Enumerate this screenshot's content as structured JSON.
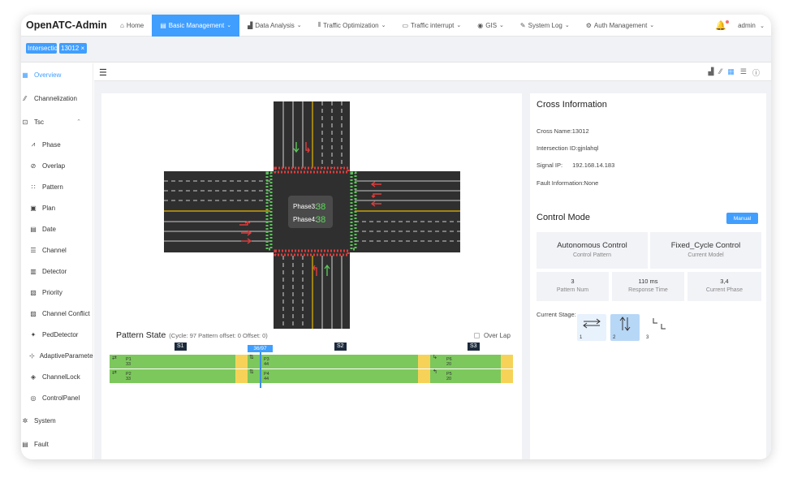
{
  "nav": {
    "brand": "OpenATC-Admin",
    "items": [
      {
        "label": "Home",
        "icon": "home-icon"
      },
      {
        "label": "Basic Management",
        "icon": "database-icon"
      },
      {
        "label": "Data Analysis",
        "icon": "chart-icon"
      },
      {
        "label": "Traffic Optimization",
        "icon": "bars-icon"
      },
      {
        "label": "Traffic interrupt",
        "icon": "video-icon"
      },
      {
        "label": "GIS",
        "icon": "location-icon"
      },
      {
        "label": "System Log",
        "icon": "edit-icon"
      },
      {
        "label": "Auth Management",
        "icon": "gear-icon"
      }
    ],
    "user": "admin"
  },
  "tags": {
    "t1": "Intersection",
    "t2": "13012 ×"
  },
  "sidebar": {
    "items": [
      {
        "label": "Overview"
      },
      {
        "label": "Channelization"
      },
      {
        "label": "Tsc"
      },
      {
        "label": "Phase"
      },
      {
        "label": "Overlap"
      },
      {
        "label": "Pattern"
      },
      {
        "label": "Plan"
      },
      {
        "label": "Date"
      },
      {
        "label": "Channel"
      },
      {
        "label": "Detector"
      },
      {
        "label": "Priority"
      },
      {
        "label": "Channel Conflict"
      },
      {
        "label": "PedDetector"
      },
      {
        "label": "AdaptiveParameter"
      },
      {
        "label": "ChannelLock"
      },
      {
        "label": "ControlPanel"
      },
      {
        "label": "System"
      },
      {
        "label": "Fault"
      }
    ]
  },
  "intersection": {
    "phase3_label": "Phase3:",
    "phase3_value": "38",
    "phase4_label": "Phase4:",
    "phase4_value": "38"
  },
  "pattern": {
    "title": "Pattern State",
    "subtitle": "(Cycle: 97 Pattern offset: 0 Offset: 0)",
    "overlap_label": "Over Lap",
    "cursor": "36/97",
    "stages": [
      "S1",
      "S2",
      "S3"
    ],
    "phases": [
      {
        "name": "P1",
        "time": "33"
      },
      {
        "name": "P2",
        "time": "33"
      },
      {
        "name": "P3",
        "time": "44"
      },
      {
        "name": "P4",
        "time": "44"
      },
      {
        "name": "P6",
        "time": "20"
      },
      {
        "name": "P5",
        "time": "20"
      }
    ]
  },
  "cross": {
    "title": "Cross Information",
    "name_label": "Cross Name:",
    "name": "13012",
    "id_label": "Intersection ID:",
    "id": "gjnlahql",
    "ip_label": "Signal IP:",
    "ip": "192.168.14.183",
    "fault_label": "Fault Information:",
    "fault": "None"
  },
  "control": {
    "title": "Control Mode",
    "manual_button": "Manual",
    "cards": [
      {
        "value": "Autonomous Control",
        "label": "Control Pattern"
      },
      {
        "value": "Fixed_Cycle Control",
        "label": "Current Model"
      },
      {
        "value": "3",
        "label": "Pattern Num"
      },
      {
        "value": "110 ms",
        "label": "Response Time"
      },
      {
        "value": "3,4",
        "label": "Current Phase"
      }
    ],
    "current_stage_label": "Current Stage:",
    "stages": [
      "1",
      "2",
      "3"
    ]
  },
  "colors": {
    "accent": "#409eff",
    "green": "#7cc85c",
    "yellow": "#f6d358"
  }
}
